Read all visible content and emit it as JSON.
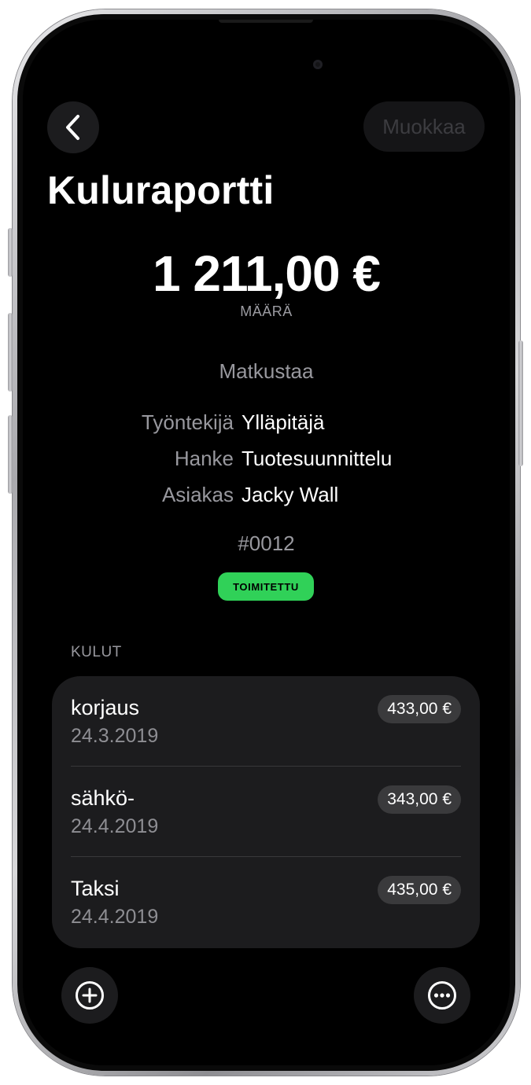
{
  "nav": {
    "back_icon": "chevron-left-icon",
    "edit_label": "Muokkaa"
  },
  "report": {
    "title": "Kuluraportti",
    "amount": "1 211,00 €",
    "amount_label": "MÄÄRÄ",
    "category": "Matkustaa",
    "details": [
      {
        "key": "Työntekijä",
        "value": "Ylläpitäjä"
      },
      {
        "key": "Hanke",
        "value": "Tuotesuunnittelu"
      },
      {
        "key": "Asiakas",
        "value": "Jacky Wall"
      }
    ],
    "number": "#0012",
    "status": "TOIMITETTU",
    "status_color": "#30d158"
  },
  "expenses": {
    "header": "KULUT",
    "items": [
      {
        "name": "korjaus",
        "date": "24.3.2019",
        "amount": "433,00 €"
      },
      {
        "name": "sähkö-",
        "date": "24.4.2019",
        "amount": "343,00 €"
      },
      {
        "name": "Taksi",
        "date": "24.4.2019",
        "amount": "435,00 €"
      }
    ]
  },
  "toolbar": {
    "add_icon": "plus-circle-icon",
    "more_icon": "ellipsis-circle-icon"
  },
  "colors": {
    "background": "#000000",
    "card": "#1c1c1e",
    "secondary_text": "#98989e"
  }
}
